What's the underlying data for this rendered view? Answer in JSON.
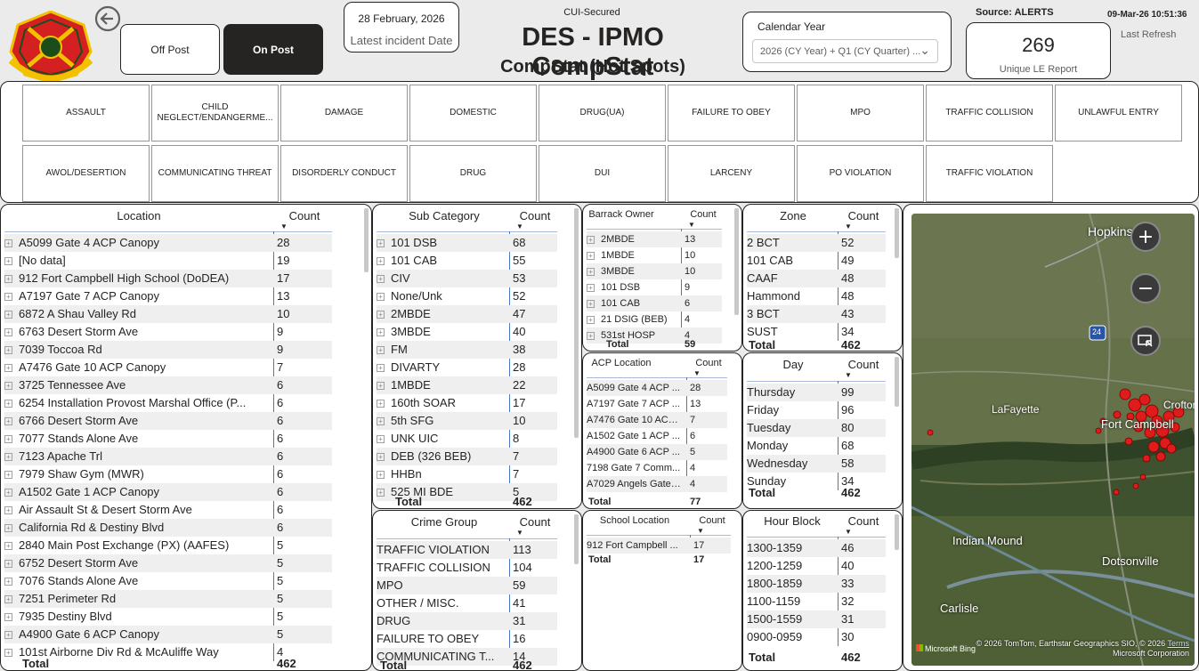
{
  "header": {
    "off_post_label": "Off Post",
    "on_post_label": "On Post",
    "latest_date": "28 February, 2026",
    "latest_date_label": "Latest incident Date",
    "classification": "CUI-Secured",
    "title": "DES - IPMO CompStat",
    "subtitle": "CompStat (Hot Spots)",
    "calendar_label": "Calendar Year",
    "calendar_value": "2026 (CY Year) + Q1 (CY Quarter) ...",
    "source": "Source: ALERTS",
    "refresh_timestamp": "09-Mar-26 10:51:36",
    "refresh_label": "Last Refresh",
    "kpi_value": "269",
    "kpi_label": "Unique LE Report"
  },
  "offense_tiles_row1": [
    "ASSAULT",
    "CHILD NEGLECT/ENDANGERME...",
    "DAMAGE",
    "DOMESTIC",
    "DRUG(UA)",
    "FAILURE TO OBEY",
    "MPO",
    "TRAFFIC COLLISION",
    "UNLAWFUL ENTRY"
  ],
  "offense_tiles_row2": [
    "AWOL/DESERTION",
    "COMMUNICATING THREAT",
    "DISORDERLY CONDUCT",
    "DRUG",
    "DUI",
    "LARCENY",
    "PO VIOLATION",
    "TRAFFIC VIOLATION"
  ],
  "location_table": {
    "col1": "Location",
    "col2": "Count",
    "rows": [
      [
        "A5099 Gate 4 ACP Canopy",
        "28"
      ],
      [
        "[No data]",
        "19"
      ],
      [
        "912 Fort Campbell High School (DoDEA)",
        "17"
      ],
      [
        "A7197 Gate 7 ACP Canopy",
        "13"
      ],
      [
        "6872 A Shau Valley Rd",
        "10"
      ],
      [
        "6763 Desert Storm Ave",
        "9"
      ],
      [
        "7039 Toccoa Rd",
        "9"
      ],
      [
        "A7476 Gate 10 ACP Canopy",
        "7"
      ],
      [
        "3725 Tennessee Ave",
        "6"
      ],
      [
        "6254 Installation Provost Marshal Office (P...",
        "6"
      ],
      [
        "6766 Desert Storm Ave",
        "6"
      ],
      [
        "7077 Stands Alone Ave",
        "6"
      ],
      [
        "7123 Apache Trl",
        "6"
      ],
      [
        "7979 Shaw Gym (MWR)",
        "6"
      ],
      [
        "A1502 Gate 1 ACP Canopy",
        "6"
      ],
      [
        "Air Assault St & Desert Storm Ave",
        "6"
      ],
      [
        "California Rd & Destiny Blvd",
        "6"
      ],
      [
        "2840 Main Post Exchange (PX) (AAFES)",
        "5"
      ],
      [
        "6752 Desert Storm Ave",
        "5"
      ],
      [
        "7076 Stands Alone Ave",
        "5"
      ],
      [
        "7251 Perimeter Rd",
        "5"
      ],
      [
        "7935 Destiny Blvd",
        "5"
      ],
      [
        "A4900 Gate 6 ACP Canopy",
        "5"
      ],
      [
        "101st Airborne Div Rd & McAuliffe Way",
        "4"
      ]
    ],
    "total_label": "Total",
    "total": "462"
  },
  "subcategory_table": {
    "col1": "Sub Category",
    "col2": "Count",
    "rows": [
      [
        "101 DSB",
        "68"
      ],
      [
        "101 CAB",
        "55"
      ],
      [
        "CIV",
        "53"
      ],
      [
        "None/Unk",
        "52"
      ],
      [
        "2MBDE",
        "47"
      ],
      [
        "3MBDE",
        "40"
      ],
      [
        "FM",
        "38"
      ],
      [
        "DIVARTY",
        "28"
      ],
      [
        "1MBDE",
        "22"
      ],
      [
        "160th SOAR",
        "17"
      ],
      [
        "5th SFG",
        "10"
      ],
      [
        "UNK UIC",
        "8"
      ],
      [
        "DEB (326 BEB)",
        "7"
      ],
      [
        "HHBn",
        "7"
      ],
      [
        "525 MI BDE",
        "5"
      ]
    ],
    "total_label": "Total",
    "total": "462"
  },
  "crimegroup_table": {
    "col1": "Crime Group",
    "col2": "Count",
    "rows": [
      [
        "TRAFFIC VIOLATION",
        "113"
      ],
      [
        "TRAFFIC COLLISION",
        "104"
      ],
      [
        "MPO",
        "59"
      ],
      [
        "OTHER / MISC.",
        "41"
      ],
      [
        "DRUG",
        "31"
      ],
      [
        "FAILURE TO OBEY",
        "16"
      ],
      [
        "COMMUNICATING T...",
        "14"
      ]
    ],
    "total_label": "Total",
    "total": "462"
  },
  "barrack_table": {
    "col1": "Barrack Owner",
    "col2": "Count",
    "rows": [
      [
        "2MBDE",
        "13"
      ],
      [
        "1MBDE",
        "10"
      ],
      [
        "3MBDE",
        "10"
      ],
      [
        "101 DSB",
        "9"
      ],
      [
        "101 CAB",
        "6"
      ],
      [
        "21 DSIG (BEB)",
        "4"
      ],
      [
        "531st HOSP",
        "4"
      ]
    ],
    "total_label": "Total",
    "total": "59"
  },
  "acp_table": {
    "col1": "ACP Location",
    "col2": "Count",
    "rows": [
      [
        "A5099 Gate 4 ACP ...",
        "28"
      ],
      [
        "A7197 Gate 7 ACP ...",
        "13"
      ],
      [
        "A7476 Gate 10 ACP...",
        "7"
      ],
      [
        "A1502 Gate 1 ACP ...",
        "6"
      ],
      [
        "A4900 Gate 6 ACP ...",
        "5"
      ],
      [
        "7198 Gate 7 Comm...",
        "4"
      ],
      [
        "A7029 Angels Gate ...",
        "4"
      ]
    ],
    "total_label": "Total",
    "total": "77"
  },
  "school_table": {
    "col1": "School Location",
    "col2": "Count",
    "rows": [
      [
        "912 Fort Campbell ...",
        "17"
      ]
    ],
    "total_label": "Total",
    "total": "17"
  },
  "zone_table": {
    "col1": "Zone",
    "col2": "Count",
    "rows": [
      [
        "2 BCT",
        "52"
      ],
      [
        "101 CAB",
        "49"
      ],
      [
        "CAAF",
        "48"
      ],
      [
        "Hammond",
        "48"
      ],
      [
        "3 BCT",
        "43"
      ],
      [
        "SUST",
        "34"
      ]
    ],
    "total_label": "Total",
    "total": "462"
  },
  "day_table": {
    "col1": "Day",
    "col2": "Count",
    "rows": [
      [
        "Thursday",
        "99"
      ],
      [
        "Friday",
        "96"
      ],
      [
        "Tuesday",
        "80"
      ],
      [
        "Monday",
        "68"
      ],
      [
        "Wednesday",
        "58"
      ],
      [
        "Sunday",
        "34"
      ]
    ],
    "total_label": "Total",
    "total": "462"
  },
  "hour_table": {
    "col1": "Hour Block",
    "col2": "Count",
    "rows": [
      [
        "1300-1359",
        "46"
      ],
      [
        "1200-1259",
        "40"
      ],
      [
        "1800-1859",
        "33"
      ],
      [
        "1100-1159",
        "32"
      ],
      [
        "1500-1559",
        "31"
      ],
      [
        "0900-0959",
        "30"
      ]
    ],
    "total_label": "Total",
    "total": "462"
  },
  "map": {
    "labels": [
      "Hopkinsville",
      "LaFayette",
      "Fort Campbell",
      "Crofton",
      "Indian Mound",
      "Dotsonville",
      "Carlisle"
    ],
    "route_shield": "24",
    "attribution": "© 2026 TomTom, Earthstar Geographics SIO, © 2026",
    "attribution_link": "Terms",
    "attribution_corp": "Microsoft Corporation",
    "brand": "Microsoft Bing"
  }
}
